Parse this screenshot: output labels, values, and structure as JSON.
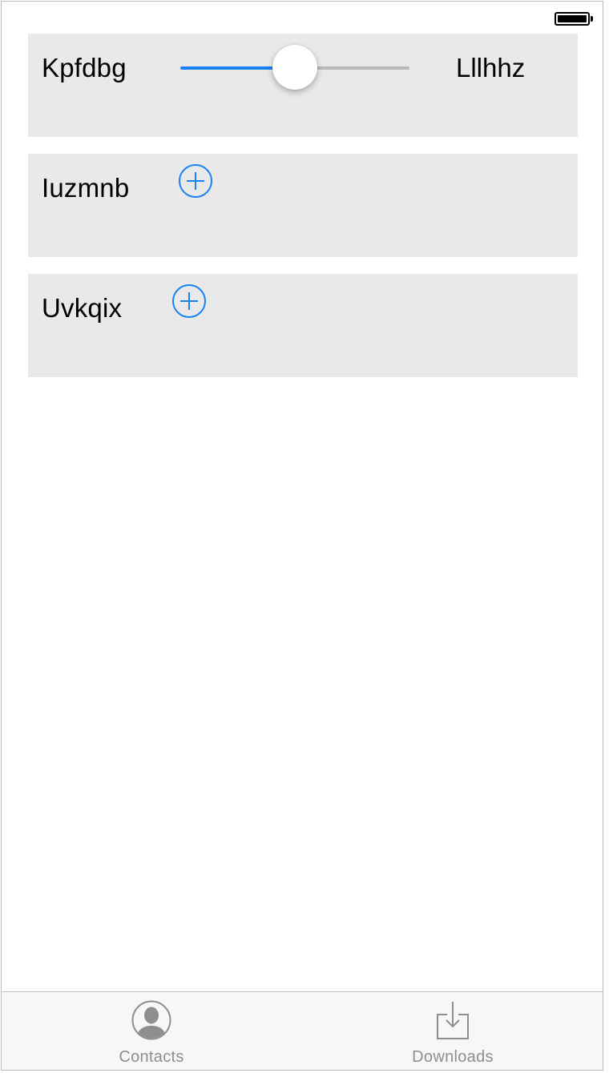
{
  "status_bar": {
    "battery_icon": "battery-full-icon"
  },
  "rows": [
    {
      "label": "Kpfdbg",
      "control": "slider",
      "slider_value_fraction": 0.5,
      "right_label": "Lllhhz"
    },
    {
      "label": "Iuzmnb",
      "control": "add-button",
      "icon": "plus-circle-icon"
    },
    {
      "label": "Uvkqix",
      "control": "add-button",
      "icon": "plus-circle-icon"
    }
  ],
  "tab_bar": {
    "tabs": [
      {
        "label": "Contacts",
        "icon": "contact-person-icon"
      },
      {
        "label": "Downloads",
        "icon": "download-tray-icon"
      }
    ]
  },
  "colors": {
    "accent": "#1a82f7",
    "track_inactive": "#b9b9b9",
    "card_background": "#e9e9e9",
    "tab_inactive": "#8e8e8e"
  }
}
